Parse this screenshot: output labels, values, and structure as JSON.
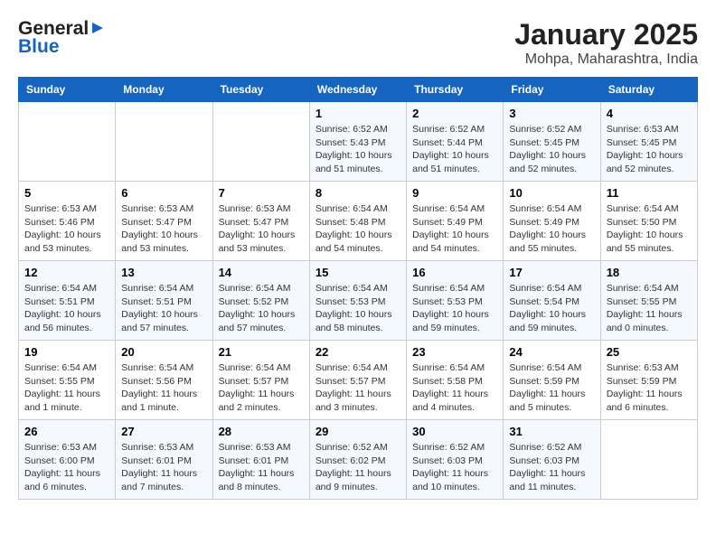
{
  "header": {
    "logo_general": "General",
    "logo_blue": "Blue",
    "month_title": "January 2025",
    "location": "Mohpa, Maharashtra, India"
  },
  "days_of_week": [
    "Sunday",
    "Monday",
    "Tuesday",
    "Wednesday",
    "Thursday",
    "Friday",
    "Saturday"
  ],
  "weeks": [
    [
      {
        "day": "",
        "info": ""
      },
      {
        "day": "",
        "info": ""
      },
      {
        "day": "",
        "info": ""
      },
      {
        "day": "1",
        "info": "Sunrise: 6:52 AM\nSunset: 5:43 PM\nDaylight: 10 hours\nand 51 minutes."
      },
      {
        "day": "2",
        "info": "Sunrise: 6:52 AM\nSunset: 5:44 PM\nDaylight: 10 hours\nand 51 minutes."
      },
      {
        "day": "3",
        "info": "Sunrise: 6:52 AM\nSunset: 5:45 PM\nDaylight: 10 hours\nand 52 minutes."
      },
      {
        "day": "4",
        "info": "Sunrise: 6:53 AM\nSunset: 5:45 PM\nDaylight: 10 hours\nand 52 minutes."
      }
    ],
    [
      {
        "day": "5",
        "info": "Sunrise: 6:53 AM\nSunset: 5:46 PM\nDaylight: 10 hours\nand 53 minutes."
      },
      {
        "day": "6",
        "info": "Sunrise: 6:53 AM\nSunset: 5:47 PM\nDaylight: 10 hours\nand 53 minutes."
      },
      {
        "day": "7",
        "info": "Sunrise: 6:53 AM\nSunset: 5:47 PM\nDaylight: 10 hours\nand 53 minutes."
      },
      {
        "day": "8",
        "info": "Sunrise: 6:54 AM\nSunset: 5:48 PM\nDaylight: 10 hours\nand 54 minutes."
      },
      {
        "day": "9",
        "info": "Sunrise: 6:54 AM\nSunset: 5:49 PM\nDaylight: 10 hours\nand 54 minutes."
      },
      {
        "day": "10",
        "info": "Sunrise: 6:54 AM\nSunset: 5:49 PM\nDaylight: 10 hours\nand 55 minutes."
      },
      {
        "day": "11",
        "info": "Sunrise: 6:54 AM\nSunset: 5:50 PM\nDaylight: 10 hours\nand 55 minutes."
      }
    ],
    [
      {
        "day": "12",
        "info": "Sunrise: 6:54 AM\nSunset: 5:51 PM\nDaylight: 10 hours\nand 56 minutes."
      },
      {
        "day": "13",
        "info": "Sunrise: 6:54 AM\nSunset: 5:51 PM\nDaylight: 10 hours\nand 57 minutes."
      },
      {
        "day": "14",
        "info": "Sunrise: 6:54 AM\nSunset: 5:52 PM\nDaylight: 10 hours\nand 57 minutes."
      },
      {
        "day": "15",
        "info": "Sunrise: 6:54 AM\nSunset: 5:53 PM\nDaylight: 10 hours\nand 58 minutes."
      },
      {
        "day": "16",
        "info": "Sunrise: 6:54 AM\nSunset: 5:53 PM\nDaylight: 10 hours\nand 59 minutes."
      },
      {
        "day": "17",
        "info": "Sunrise: 6:54 AM\nSunset: 5:54 PM\nDaylight: 10 hours\nand 59 minutes."
      },
      {
        "day": "18",
        "info": "Sunrise: 6:54 AM\nSunset: 5:55 PM\nDaylight: 11 hours\nand 0 minutes."
      }
    ],
    [
      {
        "day": "19",
        "info": "Sunrise: 6:54 AM\nSunset: 5:55 PM\nDaylight: 11 hours\nand 1 minute."
      },
      {
        "day": "20",
        "info": "Sunrise: 6:54 AM\nSunset: 5:56 PM\nDaylight: 11 hours\nand 1 minute."
      },
      {
        "day": "21",
        "info": "Sunrise: 6:54 AM\nSunset: 5:57 PM\nDaylight: 11 hours\nand 2 minutes."
      },
      {
        "day": "22",
        "info": "Sunrise: 6:54 AM\nSunset: 5:57 PM\nDaylight: 11 hours\nand 3 minutes."
      },
      {
        "day": "23",
        "info": "Sunrise: 6:54 AM\nSunset: 5:58 PM\nDaylight: 11 hours\nand 4 minutes."
      },
      {
        "day": "24",
        "info": "Sunrise: 6:54 AM\nSunset: 5:59 PM\nDaylight: 11 hours\nand 5 minutes."
      },
      {
        "day": "25",
        "info": "Sunrise: 6:53 AM\nSunset: 5:59 PM\nDaylight: 11 hours\nand 6 minutes."
      }
    ],
    [
      {
        "day": "26",
        "info": "Sunrise: 6:53 AM\nSunset: 6:00 PM\nDaylight: 11 hours\nand 6 minutes."
      },
      {
        "day": "27",
        "info": "Sunrise: 6:53 AM\nSunset: 6:01 PM\nDaylight: 11 hours\nand 7 minutes."
      },
      {
        "day": "28",
        "info": "Sunrise: 6:53 AM\nSunset: 6:01 PM\nDaylight: 11 hours\nand 8 minutes."
      },
      {
        "day": "29",
        "info": "Sunrise: 6:52 AM\nSunset: 6:02 PM\nDaylight: 11 hours\nand 9 minutes."
      },
      {
        "day": "30",
        "info": "Sunrise: 6:52 AM\nSunset: 6:03 PM\nDaylight: 11 hours\nand 10 minutes."
      },
      {
        "day": "31",
        "info": "Sunrise: 6:52 AM\nSunset: 6:03 PM\nDaylight: 11 hours\nand 11 minutes."
      },
      {
        "day": "",
        "info": ""
      }
    ]
  ]
}
